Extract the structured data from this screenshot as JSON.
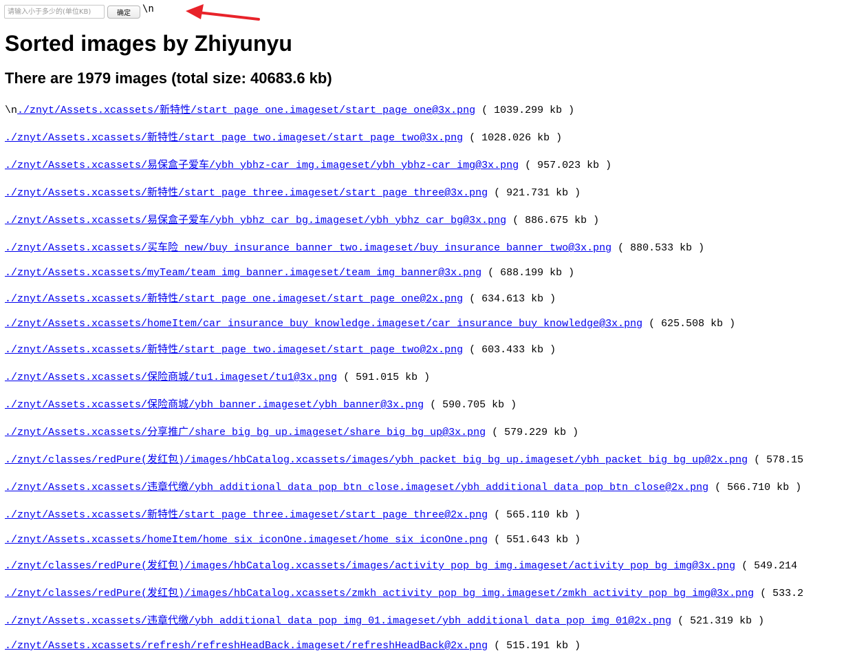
{
  "toolbar": {
    "input_placeholder": "请输入小于多少的(单位KB)",
    "confirm_label": "确定",
    "stray_text": "\\n"
  },
  "title": "Sorted images by Zhiyunyu",
  "summary": "There are 1979 images (total size: 40683.6 kb)",
  "first_prefix": "\\n",
  "files": [
    {
      "path": "./znyt/Assets.xcassets/新特性/start_page_one.imageset/start_page_one@3x.png",
      "size": "( 1039.299 kb )"
    },
    {
      "path": "./znyt/Assets.xcassets/新特性/start_page_two.imageset/start_page_two@3x.png",
      "size": "( 1028.026 kb )"
    },
    {
      "path": "./znyt/Assets.xcassets/易保盒子爱车/ybh_ybhz-car_img.imageset/ybh_ybhz-car_img@3x.png",
      "size": "( 957.023 kb )"
    },
    {
      "path": "./znyt/Assets.xcassets/新特性/start_page_three.imageset/start_page_three@3x.png",
      "size": "( 921.731 kb )"
    },
    {
      "path": "./znyt/Assets.xcassets/易保盒子爱车/ybh_ybhz_car_bg.imageset/ybh_ybhz_car_bg@3x.png",
      "size": "( 886.675 kb )"
    },
    {
      "path": "./znyt/Assets.xcassets/买车险_new/buy_insurance_banner_two.imageset/buy_insurance_banner_two@3x.png",
      "size": "( 880.533 kb )"
    },
    {
      "path": "./znyt/Assets.xcassets/myTeam/team_img_banner.imageset/team_img_banner@3x.png",
      "size": "( 688.199 kb )"
    },
    {
      "path": "./znyt/Assets.xcassets/新特性/start_page_one.imageset/start_page_one@2x.png",
      "size": "( 634.613 kb )"
    },
    {
      "path": "./znyt/Assets.xcassets/homeItem/car_insurance_buy_knowledge.imageset/car_insurance_buy_knowledge@3x.png",
      "size": "( 625.508 kb )"
    },
    {
      "path": "./znyt/Assets.xcassets/新特性/start_page_two.imageset/start_page_two@2x.png",
      "size": "( 603.433 kb )"
    },
    {
      "path": "./znyt/Assets.xcassets/保险商城/tu1.imageset/tu1@3x.png",
      "size": "( 591.015 kb )"
    },
    {
      "path": "./znyt/Assets.xcassets/保险商城/ybh_banner.imageset/ybh_banner@3x.png",
      "size": "( 590.705 kb )"
    },
    {
      "path": "./znyt/Assets.xcassets/分享推广/share_big_bg_up.imageset/share_big_bg_up@3x.png",
      "size": "( 579.229 kb )"
    },
    {
      "path": "./znyt/classes/redPure(发红包)/images/hbCatalog.xcassets/images/ybh_packet_big_bg_up.imageset/ybh_packet_big_bg_up@2x.png",
      "size": "( 578.15"
    },
    {
      "path": "./znyt/Assets.xcassets/违章代缴/ybh_additional_data_pop_btn_close.imageset/ybh_additional_data_pop_btn_close@2x.png",
      "size": "( 566.710 kb )"
    },
    {
      "path": "./znyt/Assets.xcassets/新特性/start_page_three.imageset/start_page_three@2x.png",
      "size": "( 565.110 kb )"
    },
    {
      "path": "./znyt/Assets.xcassets/homeItem/home_six_iconOne.imageset/home_six_iconOne.png",
      "size": "( 551.643 kb )"
    },
    {
      "path": "./znyt/classes/redPure(发红包)/images/hbCatalog.xcassets/images/activity_pop_bg_img.imageset/activity_pop_bg_img@3x.png",
      "size": "( 549.214"
    },
    {
      "path": "./znyt/classes/redPure(发红包)/images/hbCatalog.xcassets/zmkh_activity_pop_bg_img.imageset/zmkh_activity_pop_bg_img@3x.png",
      "size": "( 533.2"
    },
    {
      "path": "./znyt/Assets.xcassets/违章代缴/ybh_additional_data_pop_img_01.imageset/ybh_additional_data_pop_img_01@2x.png",
      "size": "( 521.319 kb )"
    },
    {
      "path": "./znyt/Assets.xcassets/refresh/refreshHeadBack.imageset/refreshHeadBack@2x.png",
      "size": "( 515.191 kb )"
    }
  ]
}
